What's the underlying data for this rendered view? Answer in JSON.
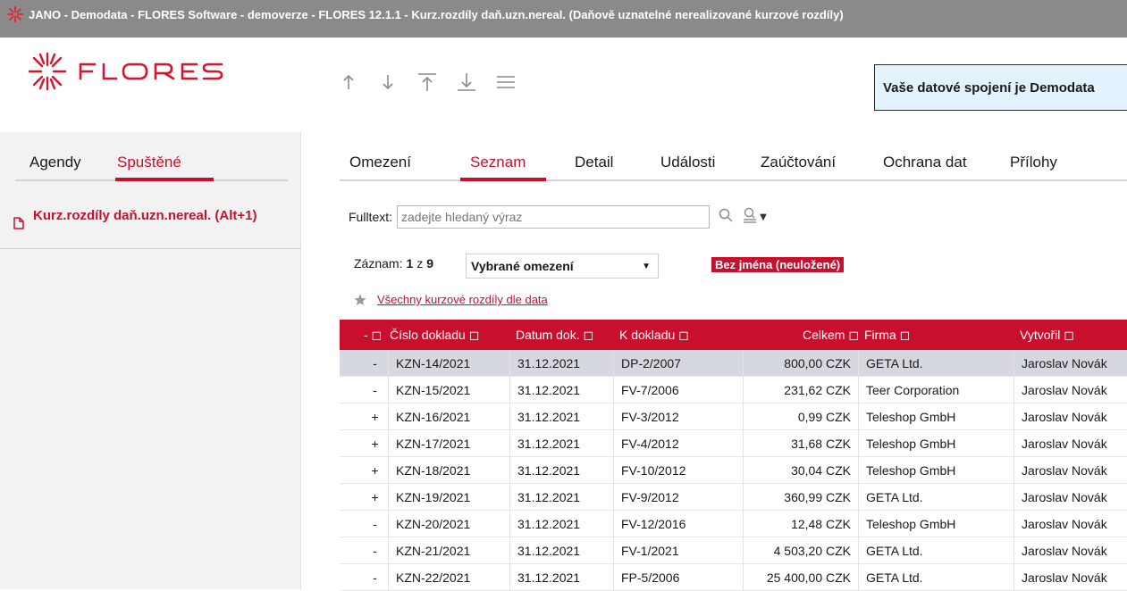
{
  "window": {
    "title": "JANO - Demodata - FLORES Software - demoverze - FLORES 12.1.1 - Kurz.rozdíly daň.uzn.nereal.  (Daňově uznatelné nerealizované kurzové rozdíly)"
  },
  "brand": {
    "logo_text": "FLORES",
    "accent": "#c8102e",
    "title_bar_color": "#8a8a8a"
  },
  "toolbar": {
    "buttons": [
      "arrow-up",
      "arrow-down",
      "move-to-top",
      "move-to-bottom",
      "menu"
    ]
  },
  "connection": {
    "text": "Vaše datové spojení je Demodata"
  },
  "sidebar": {
    "tabs": [
      {
        "label": "Agendy",
        "active": false
      },
      {
        "label": "Spuštěné",
        "active": true
      }
    ],
    "items": [
      {
        "label": "Kurz.rozdíly daň.uzn.nereal. (Alt+1)",
        "icon": "document-icon"
      }
    ]
  },
  "main": {
    "tabs": [
      {
        "label": "Omezení",
        "active": false
      },
      {
        "label": "Seznam",
        "active": true
      },
      {
        "label": "Detail",
        "active": false
      },
      {
        "label": "Události",
        "active": false
      },
      {
        "label": "Zaúčtování",
        "active": false
      },
      {
        "label": "Ochrana dat",
        "active": false
      },
      {
        "label": "Přílohy",
        "active": false
      }
    ],
    "fulltext": {
      "label": "Fulltext:",
      "placeholder": "zadejte hledaný výraz",
      "value": ""
    },
    "record": {
      "label": "Záznam:",
      "current": "1",
      "of_label": "z",
      "total": "9"
    },
    "filter": {
      "selected": "Vybrané omezení",
      "badge": "Bez jména (neuložené)"
    },
    "favorite": {
      "label": "Všechny kurzové rozdíly dle data"
    },
    "grid": {
      "columns": [
        "-",
        "Číslo dokladu",
        "Datum dok.",
        "K dokladu",
        "Celkem",
        "Firma",
        "Vytvořil"
      ],
      "rows": [
        {
          "sign": "-",
          "number": "KZN-14/2021",
          "date": "31.12.2021",
          "ref": "DP-2/2007",
          "total": "800,00 CZK",
          "company": "GETA Ltd.",
          "created_by": "Jaroslav Novák",
          "selected": true
        },
        {
          "sign": "-",
          "number": "KZN-15/2021",
          "date": "31.12.2021",
          "ref": "FV-7/2006",
          "total": "231,62 CZK",
          "company": "Teer Corporation",
          "created_by": "Jaroslav Novák",
          "selected": false
        },
        {
          "sign": "+",
          "number": "KZN-16/2021",
          "date": "31.12.2021",
          "ref": "FV-3/2012",
          "total": "0,99 CZK",
          "company": "Teleshop GmbH",
          "created_by": "Jaroslav Novák",
          "selected": false
        },
        {
          "sign": "+",
          "number": "KZN-17/2021",
          "date": "31.12.2021",
          "ref": "FV-4/2012",
          "total": "31,68 CZK",
          "company": "Teleshop GmbH",
          "created_by": "Jaroslav Novák",
          "selected": false
        },
        {
          "sign": "+",
          "number": "KZN-18/2021",
          "date": "31.12.2021",
          "ref": "FV-10/2012",
          "total": "30,04 CZK",
          "company": "Teleshop GmbH",
          "created_by": "Jaroslav Novák",
          "selected": false
        },
        {
          "sign": "+",
          "number": "KZN-19/2021",
          "date": "31.12.2021",
          "ref": "FV-9/2012",
          "total": "360,99 CZK",
          "company": "GETA Ltd.",
          "created_by": "Jaroslav Novák",
          "selected": false
        },
        {
          "sign": "-",
          "number": "KZN-20/2021",
          "date": "31.12.2021",
          "ref": "FV-12/2016",
          "total": "12,48 CZK",
          "company": "Teleshop GmbH",
          "created_by": "Jaroslav Novák",
          "selected": false
        },
        {
          "sign": "-",
          "number": "KZN-21/2021",
          "date": "31.12.2021",
          "ref": "FV-1/2021",
          "total": "4 503,20 CZK",
          "company": "GETA Ltd.",
          "created_by": "Jaroslav Novák",
          "selected": false
        },
        {
          "sign": "-",
          "number": "KZN-22/2021",
          "date": "31.12.2021",
          "ref": "FP-5/2006",
          "total": "25 400,00 CZK",
          "company": "GETA Ltd.",
          "created_by": "Jaroslav Novák",
          "selected": false
        }
      ]
    }
  }
}
